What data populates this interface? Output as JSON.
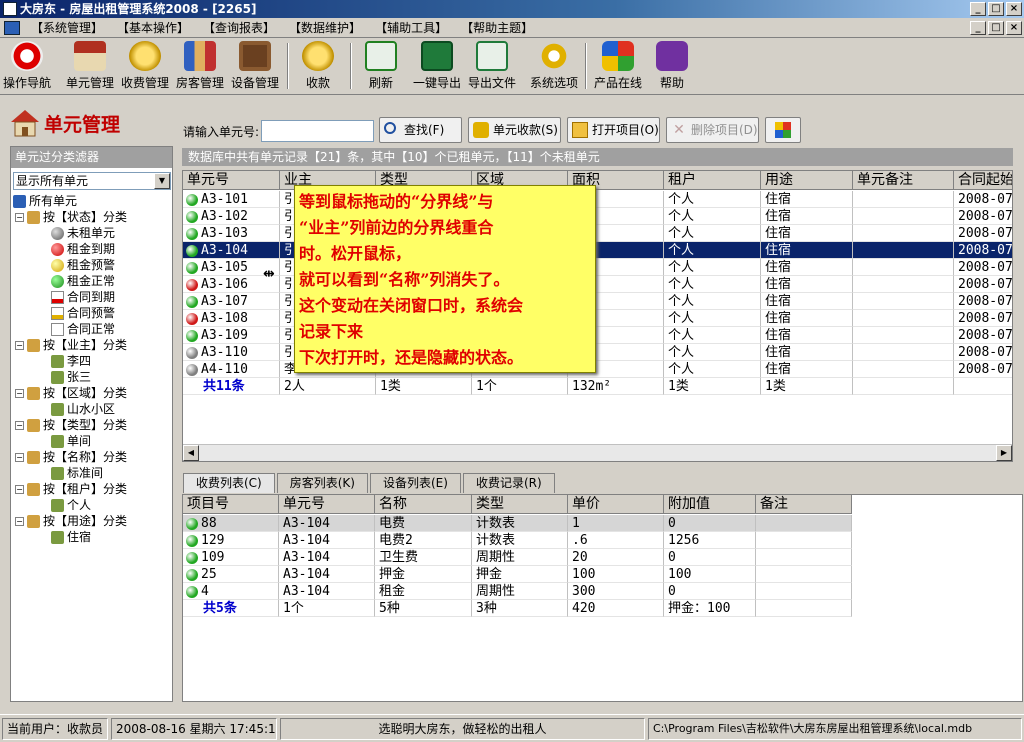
{
  "window": {
    "title": "大房东 - 房屋出租管理系统2008 - [2265]"
  },
  "menu": [
    "【系统管理】",
    "【基本操作】",
    "【查询报表】",
    "【数据维护】",
    "【辅助工具】",
    "【帮助主题】"
  ],
  "toolbar": [
    {
      "label": "操作导航",
      "icon": "navigation-icon"
    },
    {
      "label": "单元管理",
      "icon": "house-icon"
    },
    {
      "label": "收费管理",
      "icon": "coins-icon"
    },
    {
      "label": "房客管理",
      "icon": "tenants-icon"
    },
    {
      "label": "设备管理",
      "icon": "tv-icon"
    },
    {
      "label": "收款",
      "icon": "coins-icon"
    },
    {
      "label": "刷新",
      "icon": "refresh-icon"
    },
    {
      "label": "一键导出",
      "icon": "excel-icon"
    },
    {
      "label": "导出文件",
      "icon": "export-file-icon"
    },
    {
      "label": "系统选项",
      "icon": "gear-icon"
    },
    {
      "label": "产品在线",
      "icon": "windows-logo-icon"
    },
    {
      "label": "帮助",
      "icon": "help-icon"
    }
  ],
  "page": {
    "title": "单元管理"
  },
  "filter": {
    "header": "单元过分类滤器",
    "selected": "显示所有单元",
    "tree": [
      "所有单元",
      "按【状态】分类",
      "未租单元",
      "租金到期",
      "租金预警",
      "租金正常",
      "合同到期",
      "合同预警",
      "合同正常",
      "按【业主】分类",
      "李四",
      "张三",
      "按【区域】分类",
      "山水小区",
      "按【类型】分类",
      "单间",
      "按【名称】分类",
      "标准间",
      "按【租户】分类",
      "个人",
      "按【用途】分类",
      "住宿"
    ]
  },
  "search": {
    "label": "请输入单元号:",
    "value": ""
  },
  "buttons": {
    "find": "查找(F)",
    "collect": "单元收款(S)",
    "open": "打开项目(O)",
    "delete": "删除项目(D)"
  },
  "info_bar": "数据库中共有单元记录【21】条，其中【10】个已租单元，【11】个未租单元",
  "units_table": {
    "columns": [
      "单元号",
      "业主",
      "类型",
      "区域",
      "面积",
      "租户",
      "用途",
      "单元备注",
      "合同起始"
    ],
    "rows": [
      {
        "status": "green",
        "unit": "A3-101",
        "owner": "引",
        "tenant": "个人",
        "use": "住宿",
        "start": "2008-07"
      },
      {
        "status": "green",
        "unit": "A3-102",
        "owner": "引",
        "tenant": "个人",
        "use": "住宿",
        "start": "2008-07"
      },
      {
        "status": "green",
        "unit": "A3-103",
        "owner": "引",
        "tenant": "个人",
        "use": "住宿",
        "start": "2008-07"
      },
      {
        "status": "green",
        "unit": "A3-104",
        "owner": "引",
        "tenant": "个人",
        "use": "住宿",
        "start": "2008-07"
      },
      {
        "status": "green",
        "unit": "A3-105",
        "owner": "引",
        "tenant": "个人",
        "use": "住宿",
        "start": "2008-07"
      },
      {
        "status": "red",
        "unit": "A3-106",
        "owner": "引",
        "tenant": "个人",
        "use": "住宿",
        "start": "2008-07"
      },
      {
        "status": "green",
        "unit": "A3-107",
        "owner": "引",
        "tenant": "个人",
        "use": "住宿",
        "start": "2008-07"
      },
      {
        "status": "red",
        "unit": "A3-108",
        "owner": "引",
        "tenant": "个人",
        "use": "住宿",
        "start": "2008-07"
      },
      {
        "status": "green",
        "unit": "A3-109",
        "owner": "引",
        "tenant": "个人",
        "use": "住宿",
        "start": "2008-07"
      },
      {
        "status": "gray",
        "unit": "A3-110",
        "owner": "引",
        "tenant": "个人",
        "use": "住宿",
        "start": "2008-07"
      },
      {
        "status": "gray",
        "unit": "A4-110",
        "owner": "李",
        "tenant": "个人",
        "use": "住宿",
        "start": "2008-07"
      }
    ],
    "totals": {
      "unit": "共11条",
      "owner": "2人",
      "type": "1类",
      "area_region": "1个",
      "area": "132m²",
      "tenant": "1类",
      "use": "1类"
    }
  },
  "tooltip": [
    "等到鼠标拖动的“分界线”与",
    "“业主”列前边的分界线重合",
    "时。松开鼠标，",
    "就可以看到“名称”列消失了。",
    "这个变动在关闭窗口时，系统会",
    "记录下来",
    "下次打开时，还是隐藏的状态。"
  ],
  "tabs": [
    "收费列表(C)",
    "房客列表(K)",
    "设备列表(E)",
    "收费记录(R)"
  ],
  "fees_table": {
    "columns": [
      "项目号",
      "单元号",
      "名称",
      "类型",
      "单价",
      "附加值",
      "备注"
    ],
    "rows": [
      {
        "id": "88",
        "unit": "A3-104",
        "name": "电费",
        "type": "计数表",
        "price": "1",
        "extra": "0"
      },
      {
        "id": "129",
        "unit": "A3-104",
        "name": "电费2",
        "type": "计数表",
        "price": ".6",
        "extra": "1256"
      },
      {
        "id": "109",
        "unit": "A3-104",
        "name": "卫生费",
        "type": "周期性",
        "price": "20",
        "extra": "0"
      },
      {
        "id": "25",
        "unit": "A3-104",
        "name": "押金",
        "type": "押金",
        "price": "100",
        "extra": "100"
      },
      {
        "id": "4",
        "unit": "A3-104",
        "name": "租金",
        "type": "周期性",
        "price": "300",
        "extra": "0"
      }
    ],
    "totals": {
      "id": "共5条",
      "unit": "1个",
      "name": "5种",
      "type": "3种",
      "price": "420",
      "extra": "押金：100"
    }
  },
  "status": {
    "user": "当前用户：收款员",
    "datetime": "2008-08-16 星期六 17:45:14",
    "slogan": "选聪明大房东，做轻松的出租人",
    "path": "C:\\Program Files\\吉松软件\\大房东房屋出租管理系统\\local.mdb"
  },
  "colors": {
    "green": "#22a822",
    "red": "#d01818",
    "gray": "#808080",
    "accent": "#c00000"
  }
}
